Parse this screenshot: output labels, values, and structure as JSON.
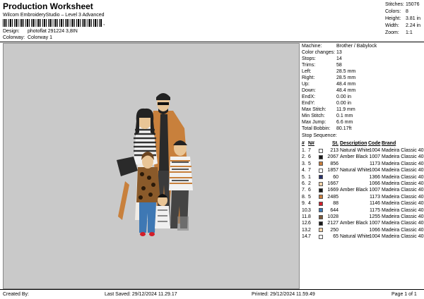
{
  "header": {
    "title": "Production Worksheet",
    "subtitle": "Wilcom EmbroideryStudio – Level 3 Advanced",
    "barcode_suffix": ", ",
    "design_label": "Design:",
    "design_value": "photoflat 291224 3,8IN",
    "colorway_label": "Colorway:",
    "colorway_value": "Colorway 1"
  },
  "summary": [
    {
      "label": "Stitches:",
      "value": "15076"
    },
    {
      "label": "Colors:",
      "value": "8"
    },
    {
      "label": "Height:",
      "value": "3.81 in"
    },
    {
      "label": "Width:",
      "value": "2.24 in"
    },
    {
      "label": "Zoom:",
      "value": "1:1"
    }
  ],
  "machine_info": [
    {
      "label": "Machine:",
      "value": "Brother / Babylock"
    },
    {
      "label": "Color changes:",
      "value": "13"
    },
    {
      "label": "Stops:",
      "value": "14"
    },
    {
      "label": "Trims:",
      "value": "58"
    },
    {
      "label": "Left:",
      "value": "28.5 mm"
    },
    {
      "label": "Right:",
      "value": "28.5 mm"
    },
    {
      "label": "Up:",
      "value": "48.4 mm"
    },
    {
      "label": "Down:",
      "value": "48.4 mm"
    },
    {
      "label": "EndX:",
      "value": "0.00 in"
    },
    {
      "label": "EndY:",
      "value": "0.00 in"
    },
    {
      "label": "Max Stitch:",
      "value": "11.9 mm"
    },
    {
      "label": "Min Stitch:",
      "value": "0.1 mm"
    },
    {
      "label": "Max Jump:",
      "value": "6.6 mm"
    },
    {
      "label": "Total Bobbin:",
      "value": "80.17ft"
    }
  ],
  "stop_sequence": {
    "title": "Stop Sequence:",
    "headers": {
      "num": "#",
      "n": "N#",
      "st": "St.",
      "desc": "Description",
      "code": "Code",
      "brand": "Brand"
    },
    "rows": [
      {
        "num": "1.",
        "n": "7",
        "color": "#ffffff",
        "st": "213",
        "desc": "Natural White",
        "code": "1004",
        "brand": "Madeira Classic 40"
      },
      {
        "num": "2.",
        "n": "6",
        "color": "#1a1a1a",
        "st": "2067",
        "desc": "Amber Black",
        "code": "1007",
        "brand": "Madeira Classic 40"
      },
      {
        "num": "3.",
        "n": "5",
        "color": "#c87e3e",
        "st": "856",
        "desc": "",
        "code": "1173",
        "brand": "Madeira Classic 40"
      },
      {
        "num": "4.",
        "n": "7",
        "color": "#ffffff",
        "st": "1857",
        "desc": "Natural White",
        "code": "1004",
        "brand": "Madeira Classic 40"
      },
      {
        "num": "5.",
        "n": "1",
        "color": "#27306b",
        "st": "60",
        "desc": "",
        "code": "1366",
        "brand": "Madeira Classic 40"
      },
      {
        "num": "6.",
        "n": "2",
        "color": "#f2d2a8",
        "st": "1667",
        "desc": "",
        "code": "1066",
        "brand": "Madeira Classic 40"
      },
      {
        "num": "7.",
        "n": "6",
        "color": "#1a1a1a",
        "st": "1669",
        "desc": "Amber Black",
        "code": "1007",
        "brand": "Madeira Classic 40"
      },
      {
        "num": "8.",
        "n": "5",
        "color": "#c87e3e",
        "st": "2485",
        "desc": "",
        "code": "1173",
        "brand": "Madeira Classic 40"
      },
      {
        "num": "9.",
        "n": "4",
        "color": "#d21e2a",
        "st": "88",
        "desc": "",
        "code": "1146",
        "brand": "Madeira Classic 40"
      },
      {
        "num": "10.",
        "n": "3",
        "color": "#3e78b4",
        "st": "644",
        "desc": "",
        "code": "1175",
        "brand": "Madeira Classic 40"
      },
      {
        "num": "11.",
        "n": "8",
        "color": "#7a5a3a",
        "st": "1028",
        "desc": "",
        "code": "1255",
        "brand": "Madeira Classic 40"
      },
      {
        "num": "12.",
        "n": "6",
        "color": "#1a1a1a",
        "st": "2127",
        "desc": "Amber Black",
        "code": "1007",
        "brand": "Madeira Classic 40"
      },
      {
        "num": "13.",
        "n": "2",
        "color": "#f2d2a8",
        "st": "250",
        "desc": "",
        "code": "1066",
        "brand": "Madeira Classic 40"
      },
      {
        "num": "14.",
        "n": "7",
        "color": "#ffffff",
        "st": "65",
        "desc": "Natural White",
        "code": "1004",
        "brand": "Madeira Classic 40"
      }
    ]
  },
  "footer": {
    "created": "Created By:",
    "saved": "Last Saved: 29/12/2024 11.29.17",
    "printed": "Printed: 29/12/2024 11.59.49",
    "page": "Page 1 of 1"
  },
  "colors": {
    "canvas_bg": "#c9c9c9"
  }
}
